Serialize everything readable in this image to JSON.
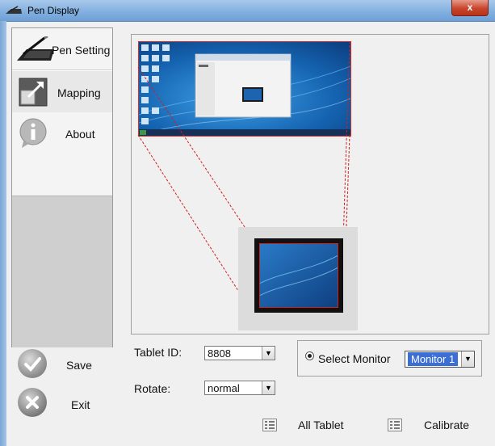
{
  "window": {
    "title": "Pen Display",
    "close_label": "x"
  },
  "sidebar": {
    "items": [
      {
        "label": "Pen Setting",
        "icon": "pen-tablet-icon"
      },
      {
        "label": "Mapping",
        "icon": "mapping-icon"
      },
      {
        "label": "About",
        "icon": "info-icon"
      }
    ]
  },
  "actions": {
    "save_label": "Save",
    "exit_label": "Exit"
  },
  "settings": {
    "tablet_id_label": "Tablet ID:",
    "tablet_id_value": "8808",
    "rotate_label": "Rotate:",
    "rotate_value": "normal",
    "select_monitor_label": "Select Monitor",
    "monitor_value": "Monitor 1"
  },
  "footer": {
    "all_tablet_label": "All Tablet",
    "calibrate_label": "Calibrate"
  },
  "colors": {
    "accent": "#3b6fd6",
    "mapping_line": "#d02020",
    "desktop_bg": "#1a6ab0"
  }
}
